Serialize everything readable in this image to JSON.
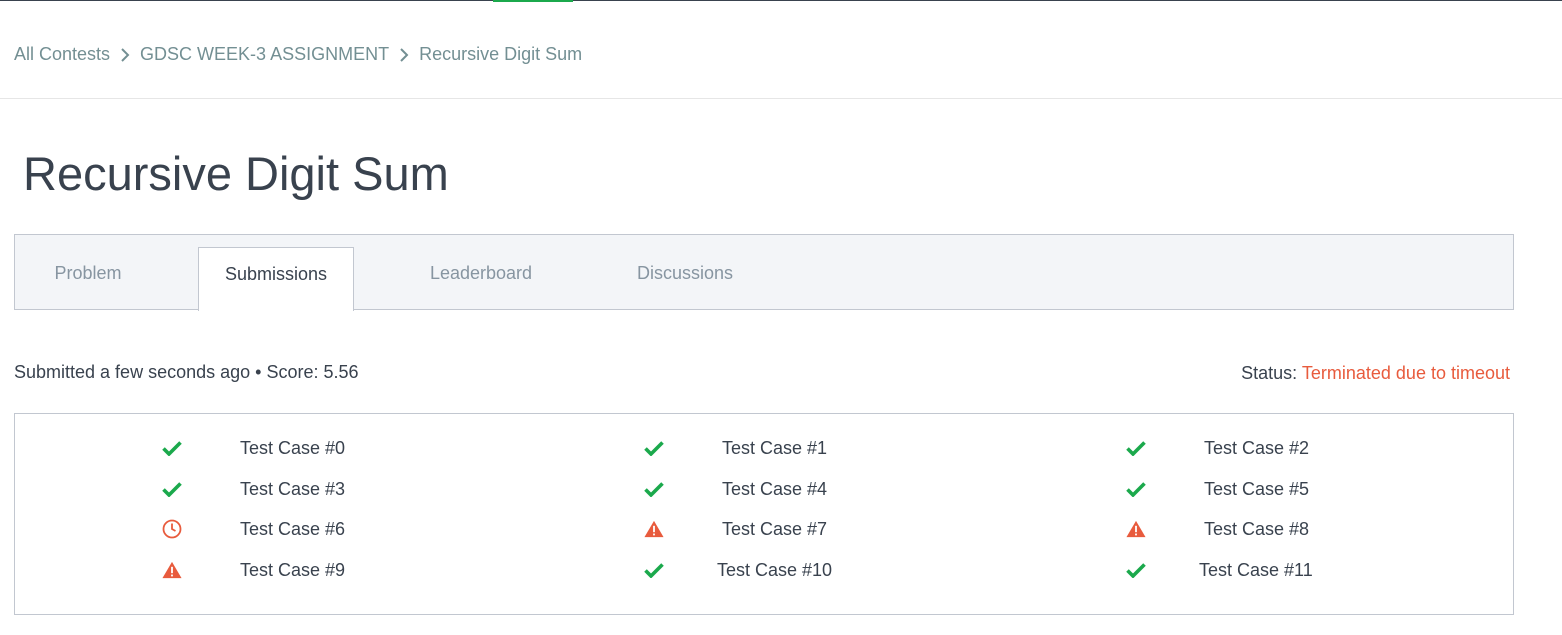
{
  "breadcrumb": {
    "items": [
      "All Contests",
      "GDSC WEEK-3 ASSIGNMENT",
      "Recursive Digit Sum"
    ]
  },
  "page": {
    "title": "Recursive Digit Sum"
  },
  "tabs": {
    "items": [
      "Problem",
      "Submissions",
      "Leaderboard",
      "Discussions"
    ],
    "active": "Submissions"
  },
  "submission": {
    "summary": "Submitted a few seconds ago • Score: 5.56",
    "status_label": "Status:",
    "status_value": "Terminated due to timeout"
  },
  "colors": {
    "success": "#1ba94c",
    "error": "#e85b3d",
    "text": "#39424e",
    "muted": "#738f93"
  },
  "test_cases": [
    {
      "label": "Test Case #0",
      "result": "passed",
      "icon": "check-icon"
    },
    {
      "label": "Test Case #1",
      "result": "passed",
      "icon": "check-icon"
    },
    {
      "label": "Test Case #2",
      "result": "passed",
      "icon": "check-icon"
    },
    {
      "label": "Test Case #3",
      "result": "passed",
      "icon": "check-icon"
    },
    {
      "label": "Test Case #4",
      "result": "passed",
      "icon": "check-icon"
    },
    {
      "label": "Test Case #5",
      "result": "passed",
      "icon": "check-icon"
    },
    {
      "label": "Test Case #6",
      "result": "timeout",
      "icon": "clock-icon"
    },
    {
      "label": "Test Case #7",
      "result": "error",
      "icon": "warning-icon"
    },
    {
      "label": "Test Case #8",
      "result": "error",
      "icon": "warning-icon"
    },
    {
      "label": "Test Case #9",
      "result": "error",
      "icon": "warning-icon"
    },
    {
      "label": "Test Case #10",
      "result": "passed",
      "icon": "check-icon"
    },
    {
      "label": "Test Case #11",
      "result": "passed",
      "icon": "check-icon"
    }
  ]
}
